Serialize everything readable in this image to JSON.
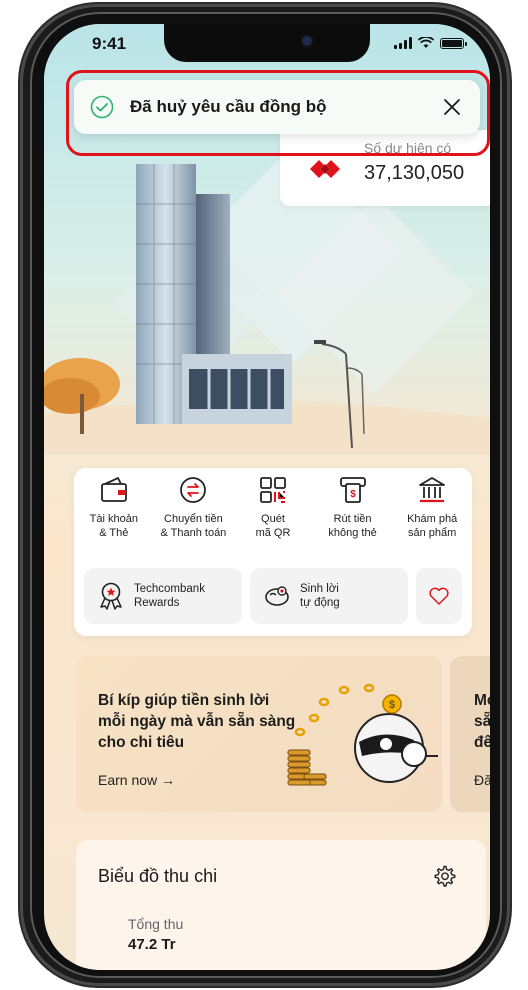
{
  "status_bar": {
    "time": "9:41"
  },
  "toast": {
    "message": "Đã huỷ yêu cầu đồng bộ"
  },
  "balance": {
    "label": "Số dư hiện có",
    "value": "37,130,050"
  },
  "quick_actions": [
    {
      "label": "Tài khoản\n& Thẻ",
      "icon": "wallet-icon"
    },
    {
      "label": "Chuyển tiền\n& Thanh toán",
      "icon": "transfer-icon"
    },
    {
      "label": "Quét\nmã QR",
      "icon": "qr-icon"
    },
    {
      "label": "Rút tiền\nkhông thẻ",
      "icon": "atm-icon"
    },
    {
      "label": "Khám phá\nsản phẩm",
      "icon": "bank-icon"
    }
  ],
  "chips": [
    {
      "label": "Techcombank\nRewards",
      "icon": "rewards-icon"
    },
    {
      "label": "Sinh lời\ntự động",
      "icon": "piggy-icon"
    },
    {
      "label": "",
      "icon": "heart-icon"
    }
  ],
  "promo": {
    "text": "Bí kíp giúp tiền sinh lời mỗi ngày mà vẫn sẵn sàng cho chi tiêu",
    "link": "Earn now →"
  },
  "promo2": {
    "text": "Mở t\nsẵn\nđến",
    "link": "Đăn"
  },
  "chart_card": {
    "title": "Biểu đồ thu chi",
    "income_label": "Tổng thu",
    "income_value": "47.2 Tr"
  },
  "colors": {
    "brand_red": "#e0131b",
    "toast_check": "#2db36b"
  }
}
